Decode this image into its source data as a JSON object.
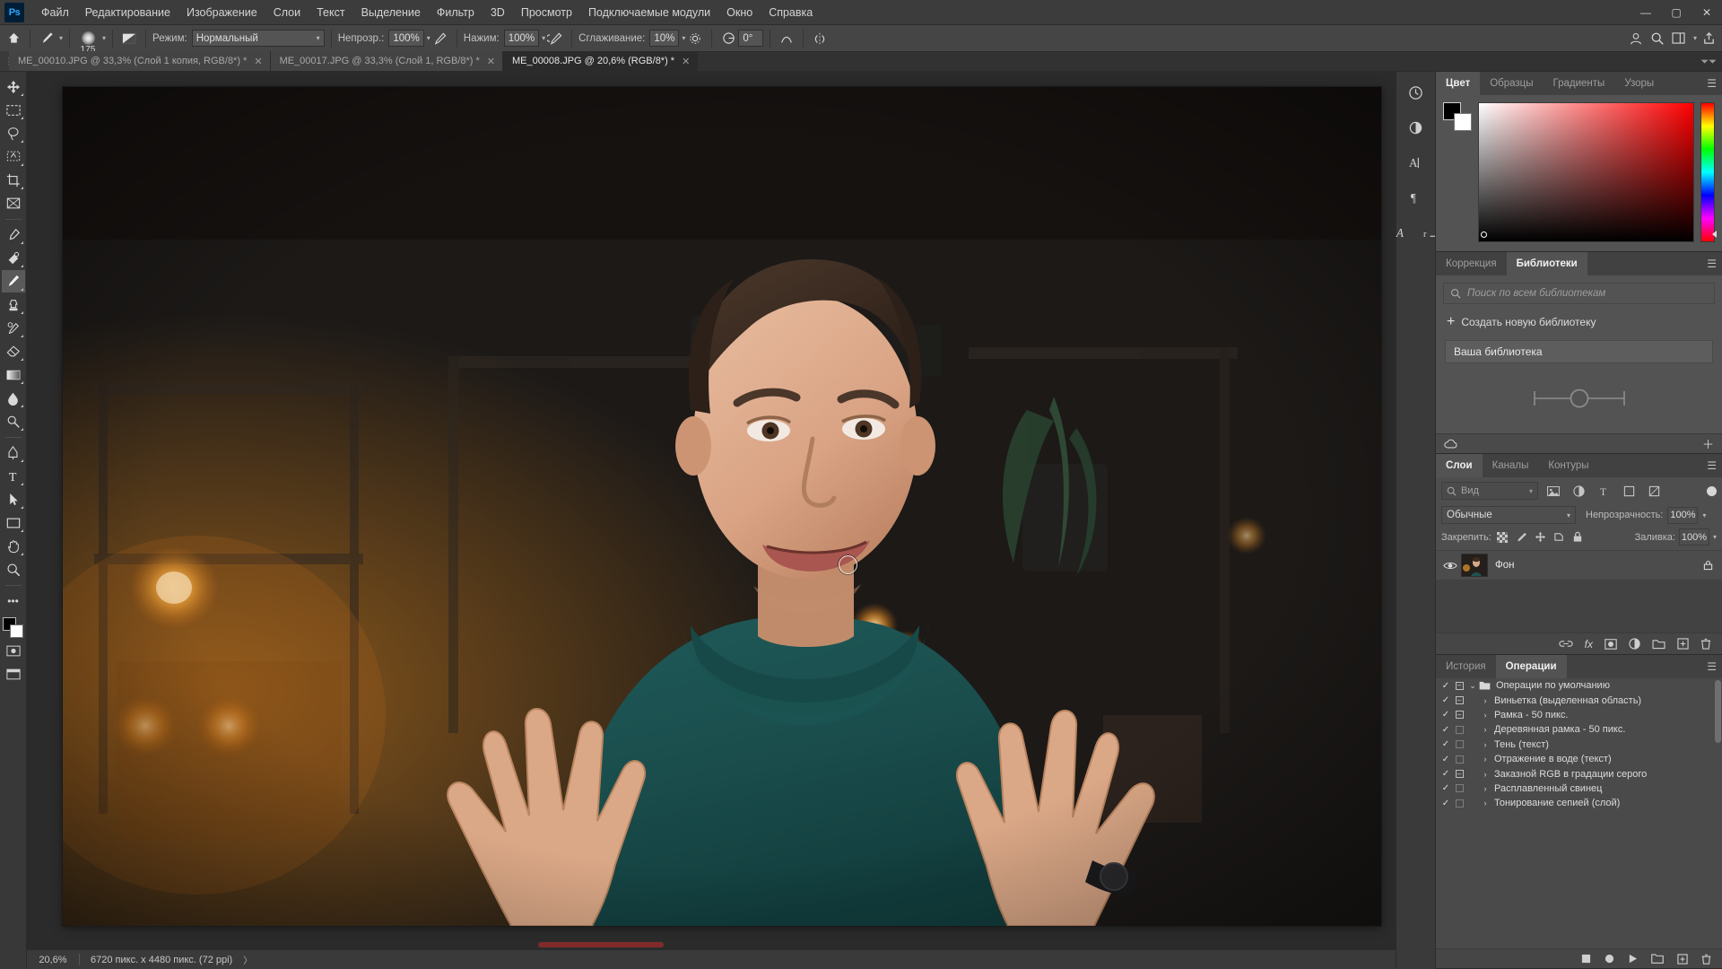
{
  "app": {
    "logo": "Ps"
  },
  "menubar": {
    "items": [
      "Файл",
      "Редактирование",
      "Изображение",
      "Слои",
      "Текст",
      "Выделение",
      "Фильтр",
      "3D",
      "Просмотр",
      "Подключаемые модули",
      "Окно",
      "Справка"
    ],
    "window_controls": {
      "minimize": "—",
      "maximize": "▢",
      "close": "✕"
    }
  },
  "options_bar": {
    "tool_preset_icon": "home-icon",
    "brush_icon": "brush-icon",
    "brush_size": "175",
    "brush_panel_icon": "brush-panel-icon",
    "mode_label": "Режим:",
    "mode_value": "Нормальный",
    "opacity_label": "Непрозр.:",
    "opacity_value": "100%",
    "opacity_pressure_icon": "pressure-opacity-icon",
    "flow_label": "Нажим:",
    "flow_value": "100%",
    "airbrush_icon": "airbrush-icon",
    "smoothing_label": "Сглаживание:",
    "smoothing_value": "10%",
    "smoothing_gear_icon": "gear-icon",
    "angle_icon": "angle-icon",
    "angle_value": "0°",
    "tablet_pressure_icon": "tablet-pressure-icon",
    "symmetry_icon": "symmetry-icon",
    "right_icons": [
      "user-icon",
      "search-icon",
      "workspace-icon",
      "share-icon"
    ]
  },
  "tabs": [
    {
      "title": "ME_00010.JPG @ 33,3% (Слой 1 копия, RGB/8*) *",
      "close": "✕",
      "active": false
    },
    {
      "title": "ME_00017.JPG @ 33,3% (Слой 1, RGB/8*) *",
      "close": "✕",
      "active": false
    },
    {
      "title": "ME_00008.JPG @ 20,6% (RGB/8*) *",
      "close": "✕",
      "active": true
    }
  ],
  "toolbar": {
    "tools": [
      {
        "name": "move-tool",
        "glyph": "move"
      },
      {
        "name": "marquee-tool",
        "glyph": "marquee"
      },
      {
        "name": "lasso-tool",
        "glyph": "lasso"
      },
      {
        "name": "object-select-tool",
        "glyph": "objsel"
      },
      {
        "name": "crop-tool",
        "glyph": "crop"
      },
      {
        "name": "frame-tool",
        "glyph": "frame"
      },
      {
        "name": "eyedropper-tool",
        "glyph": "eyedropper"
      },
      {
        "name": "spot-heal-tool",
        "glyph": "heal"
      },
      {
        "name": "brush-tool",
        "glyph": "brush"
      },
      {
        "name": "clone-stamp-tool",
        "glyph": "stamp"
      },
      {
        "name": "history-brush-tool",
        "glyph": "histbrush"
      },
      {
        "name": "eraser-tool",
        "glyph": "eraser"
      },
      {
        "name": "gradient-tool",
        "glyph": "gradient"
      },
      {
        "name": "blur-tool",
        "glyph": "blur"
      },
      {
        "name": "dodge-tool",
        "glyph": "dodge"
      },
      {
        "name": "pen-tool",
        "glyph": "pen"
      },
      {
        "name": "type-tool",
        "glyph": "type"
      },
      {
        "name": "path-select-tool",
        "glyph": "pathsel"
      },
      {
        "name": "shape-tool",
        "glyph": "shape"
      },
      {
        "name": "hand-tool",
        "glyph": "hand"
      },
      {
        "name": "zoom-tool",
        "glyph": "zoom"
      }
    ],
    "active_tool": "brush-tool",
    "edit_toolbar_glyph": "•••",
    "quickmask_icon": "quickmask-icon",
    "screenmode_icon": "screenmode-icon",
    "foreground_color": "#000000",
    "background_color": "#ffffff"
  },
  "canvas": {
    "document_name": "ME_00008.JPG",
    "cursor": "brush-cursor-circle"
  },
  "statusbar": {
    "zoom": "20,6%",
    "doc_info": "6720 пикс. x 4480 пикс. (72 ppi)",
    "expand_arrow": "〉"
  },
  "icon_rail": {
    "buttons": [
      "history-icon",
      "adjustments-icon",
      "character-icon",
      "paragraph-icon",
      "styles-icon",
      "more-icon"
    ]
  },
  "color_panel": {
    "tabs": [
      "Цвет",
      "Образцы",
      "Градиенты",
      "Узоры"
    ],
    "active_tab": "Цвет",
    "menu_icon": "panel-menu-icon",
    "foreground": "#000000",
    "background": "#ffffff",
    "field_hue": "#ff0000"
  },
  "libraries_panel": {
    "tabs": [
      "Коррекция",
      "Библиотеки"
    ],
    "active_tab": "Библиотеки",
    "menu_icon": "panel-menu-icon",
    "search_placeholder": "Поиск по всем библиотекам",
    "search_icon": "search-icon",
    "create_label": "Создать новую библиотеку",
    "create_icon": "plus-icon",
    "selected_library": "Ваша библиотека",
    "empty_icon": "empty-library-icon",
    "footer_left_icon": "cloud-icon",
    "footer_right_icon": "plus-icon"
  },
  "layers_panel": {
    "tabs": [
      "Слои",
      "Каналы",
      "Контуры"
    ],
    "active_tab": "Слои",
    "menu_icon": "panel-menu-icon",
    "filter_placeholder": "Вид",
    "filter_icons": [
      "pixel-filter-icon",
      "adjustment-filter-icon",
      "type-filter-icon",
      "shape-filter-icon",
      "smart-filter-icon"
    ],
    "blend_mode": "Обычные",
    "opacity_label": "Непрозрачность:",
    "opacity_value": "100%",
    "lock_label": "Закрепить:",
    "lock_icons": [
      "lock-transparent-icon",
      "lock-image-icon",
      "lock-position-icon",
      "lock-artboard-icon",
      "lock-all-icon"
    ],
    "fill_label": "Заливка:",
    "fill_value": "100%",
    "layers": [
      {
        "name": "Фон",
        "visible": true,
        "locked": true,
        "eye_icon": "eye-icon",
        "lock_icon": "lock-icon"
      }
    ],
    "footer_icons": [
      "link-icon",
      "fx-icon",
      "mask-icon",
      "adjustment-icon",
      "group-icon",
      "new-layer-icon",
      "delete-icon"
    ]
  },
  "actions_panel": {
    "tabs": [
      "История",
      "Операции"
    ],
    "active_tab": "Операции",
    "menu_icon": "panel-menu-icon",
    "rows": [
      {
        "checked": true,
        "box": "dash",
        "arrow": "chevron-down",
        "folder": true,
        "label": "Операции по умолчанию"
      },
      {
        "checked": true,
        "box": "dash",
        "arrow": "chevron-right",
        "folder": false,
        "label": "Виньетка (выделенная область)"
      },
      {
        "checked": true,
        "box": "dash",
        "arrow": "chevron-right",
        "folder": false,
        "label": "Рамка - 50 пикс."
      },
      {
        "checked": true,
        "box": "empty",
        "arrow": "chevron-right",
        "folder": false,
        "label": "Деревянная рамка - 50 пикс."
      },
      {
        "checked": true,
        "box": "empty",
        "arrow": "chevron-right",
        "folder": false,
        "label": "Тень (текст)"
      },
      {
        "checked": true,
        "box": "empty",
        "arrow": "chevron-right",
        "folder": false,
        "label": "Отражение в воде (текст)"
      },
      {
        "checked": true,
        "box": "dash",
        "arrow": "chevron-right",
        "folder": false,
        "label": "Заказной RGB в градации серого"
      },
      {
        "checked": true,
        "box": "empty",
        "arrow": "chevron-right",
        "folder": false,
        "label": "Расплавленный свинец"
      },
      {
        "checked": true,
        "box": "empty",
        "arrow": "chevron-right",
        "folder": false,
        "label": "Тонирование сепией (слой)"
      }
    ],
    "footer_icons": [
      "stop-icon",
      "record-icon",
      "play-icon",
      "new-set-icon",
      "new-action-icon",
      "delete-icon"
    ]
  }
}
